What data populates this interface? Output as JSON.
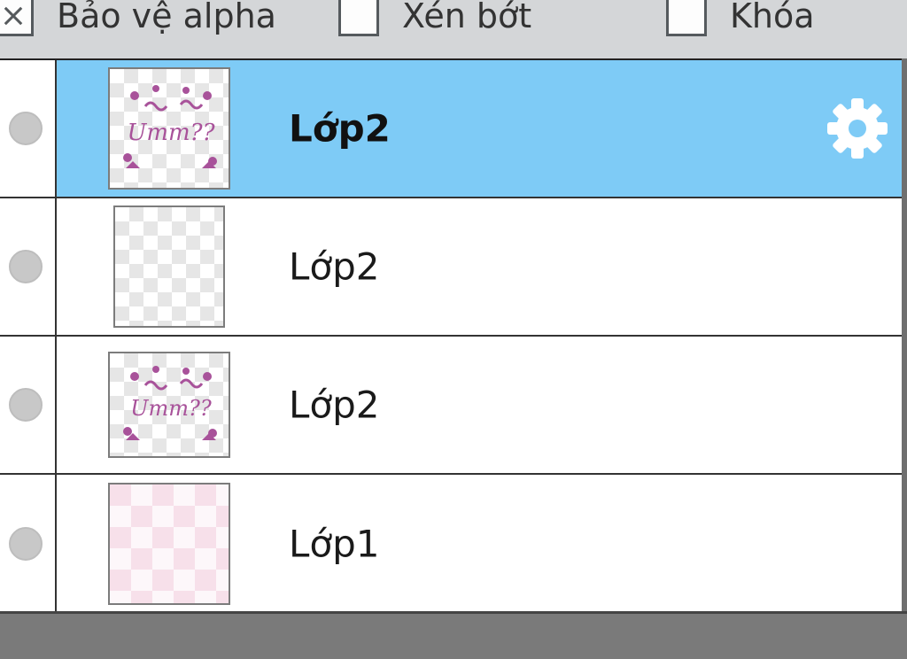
{
  "options": {
    "alpha": {
      "label": "Bảo vệ alpha",
      "checked": true
    },
    "clip": {
      "label": "Xén bớt",
      "checked": false
    },
    "lock": {
      "label": "Khóa",
      "checked": false
    }
  },
  "layers": [
    {
      "name": "Lớp2",
      "selected": true,
      "thumbnail": "decorated-text",
      "thumb_text": "Umm??"
    },
    {
      "name": "Lớp2",
      "selected": false,
      "thumbnail": "empty-transparent"
    },
    {
      "name": "Lớp2",
      "selected": false,
      "thumbnail": "decorated-text",
      "thumb_text": "Umm??"
    },
    {
      "name": "Lớp1",
      "selected": false,
      "thumbnail": "pink-checker"
    }
  ],
  "icons": {
    "visibility": "visibility-dot-icon",
    "settings": "gear-icon"
  },
  "colors": {
    "selected_row": "#7ecbf6",
    "background": "#d4d6d8",
    "footer": "#7a7a7a"
  }
}
